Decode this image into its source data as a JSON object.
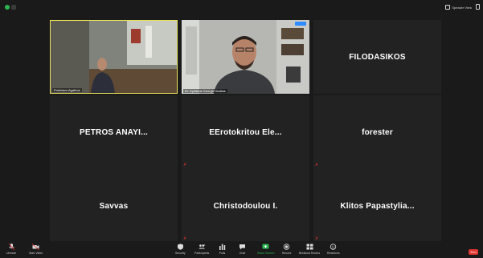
{
  "window": {
    "view_button_label": "Speaker View"
  },
  "tiles": [
    {
      "name": "",
      "caption": "Professor Agathos",
      "video": true,
      "muted": false,
      "active_speaker": true
    },
    {
      "name": "",
      "caption": "Dr. Kyriakos George Gkaitas",
      "video": true,
      "muted": false,
      "active_speaker": false
    },
    {
      "name": "FILODASIKOS",
      "caption": "",
      "video": false,
      "muted": false,
      "active_speaker": false
    },
    {
      "name": "PETROS ANAYI...",
      "caption": "",
      "video": false,
      "muted": false,
      "active_speaker": false
    },
    {
      "name": "EErotokritou Ele...",
      "caption": "",
      "video": false,
      "muted": true,
      "active_speaker": false
    },
    {
      "name": "forester",
      "caption": "",
      "video": false,
      "muted": true,
      "active_speaker": false
    },
    {
      "name": "Savvas",
      "caption": "",
      "video": false,
      "muted": false,
      "active_speaker": false
    },
    {
      "name": "Christodoulou I.",
      "caption": "",
      "video": false,
      "muted": true,
      "active_speaker": false
    },
    {
      "name": "Klitos Papastylia...",
      "caption": "",
      "video": false,
      "muted": true,
      "active_speaker": false
    }
  ],
  "toolbar": {
    "unmute": "Unmute",
    "start_video": "Start Video",
    "security": "Security",
    "participants": "Participants",
    "participants_count": "16",
    "polls": "Polls",
    "chat": "Chat",
    "share_screen": "Share Screen",
    "record": "Record",
    "breakout_rooms": "Breakout Rooms",
    "reactions": "Reactions",
    "end": "End"
  },
  "colors": {
    "background": "#1a1a1a",
    "tile": "#222222",
    "active_speaker_border": "#e9e25a",
    "share_green": "#2fb551",
    "end_red": "#e0342f"
  }
}
